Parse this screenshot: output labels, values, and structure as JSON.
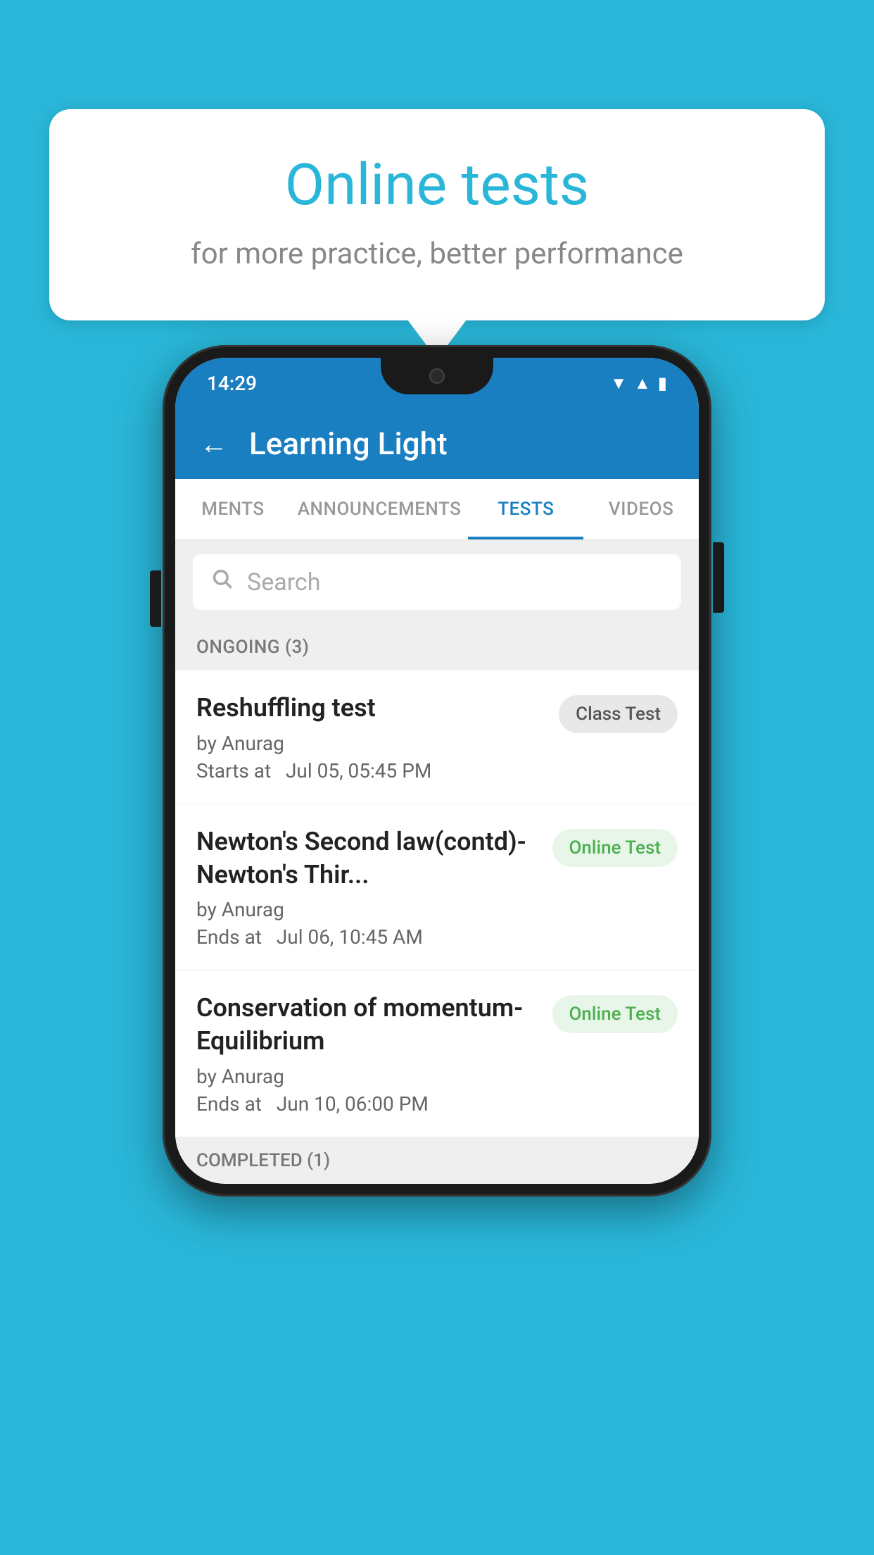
{
  "background": {
    "color": "#29b6d8"
  },
  "speech_bubble": {
    "title": "Online tests",
    "subtitle": "for more practice, better performance"
  },
  "phone": {
    "status_bar": {
      "time": "14:29",
      "wifi_icon": "▼",
      "signal_icon": "▲",
      "battery_icon": "▮"
    },
    "app_header": {
      "back_label": "←",
      "title": "Learning Light"
    },
    "tabs": [
      {
        "label": "MENTS",
        "active": false
      },
      {
        "label": "ANNOUNCEMENTS",
        "active": false
      },
      {
        "label": "TESTS",
        "active": true
      },
      {
        "label": "VIDEOS",
        "active": false
      }
    ],
    "search": {
      "placeholder": "Search"
    },
    "ongoing_section": {
      "label": "ONGOING (3)"
    },
    "tests": [
      {
        "name": "Reshuffling test",
        "author": "by Anurag",
        "time_label": "Starts at",
        "time": "Jul 05, 05:45 PM",
        "badge": "Class Test",
        "badge_type": "class"
      },
      {
        "name": "Newton's Second law(contd)-Newton's Thir...",
        "author": "by Anurag",
        "time_label": "Ends at",
        "time": "Jul 06, 10:45 AM",
        "badge": "Online Test",
        "badge_type": "online"
      },
      {
        "name": "Conservation of momentum-Equilibrium",
        "author": "by Anurag",
        "time_label": "Ends at",
        "time": "Jun 10, 06:00 PM",
        "badge": "Online Test",
        "badge_type": "online"
      }
    ],
    "completed_section": {
      "label": "COMPLETED (1)"
    }
  }
}
